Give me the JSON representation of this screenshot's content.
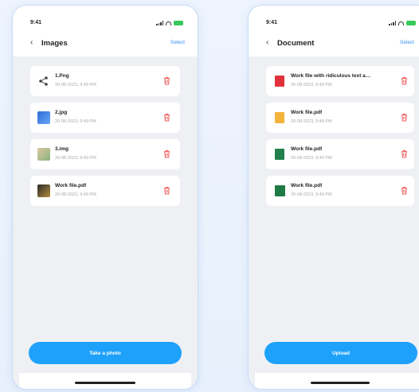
{
  "images_screen": {
    "status": {
      "time": "9:41"
    },
    "nav": {
      "back_icon": "chevron-left-icon",
      "title": "Images",
      "select_label": "Select"
    },
    "files": [
      {
        "name": "1.Png",
        "meta": "20-08-2023, 9:49 PM",
        "thumb": "share-icon"
      },
      {
        "name": "2.jpg",
        "meta": "20-08-2023, 9:49 PM",
        "thumb": "image"
      },
      {
        "name": "3.img",
        "meta": "20-08-2023, 9:49 PM",
        "thumb": "image"
      },
      {
        "name": "Work file.pdf",
        "meta": "20-08-2023, 9:49 PM",
        "thumb": "image"
      }
    ],
    "action_label": "Take a photo"
  },
  "document_screen": {
    "status": {
      "time": "9:41"
    },
    "nav": {
      "back_icon": "chevron-left-icon",
      "title": "Document",
      "select_label": "Select"
    },
    "files": [
      {
        "name": "Work file with ridiculous text a…",
        "meta": "20-08-2023, 9:49 PM",
        "thumb": "pdf-icon"
      },
      {
        "name": "Work file.pdf",
        "meta": "20-08-2023, 9:49 PM",
        "thumb": "zip-icon"
      },
      {
        "name": "Work file.pdf",
        "meta": "20-08-2023, 9:49 PM",
        "thumb": "excel-icon"
      },
      {
        "name": "Work file.pdf",
        "meta": "20-08-2023, 9:49 PM",
        "thumb": "excel-icon"
      }
    ],
    "action_label": "Upload"
  },
  "colors": {
    "accent": "#1ea1fb",
    "select_link": "#3b8ff0",
    "delete": "#f05a5a",
    "battery": "#37c95a"
  },
  "icons": {
    "delete": "trash-icon",
    "signal": "signal-icon",
    "wifi": "wifi-icon",
    "battery": "battery-icon"
  }
}
